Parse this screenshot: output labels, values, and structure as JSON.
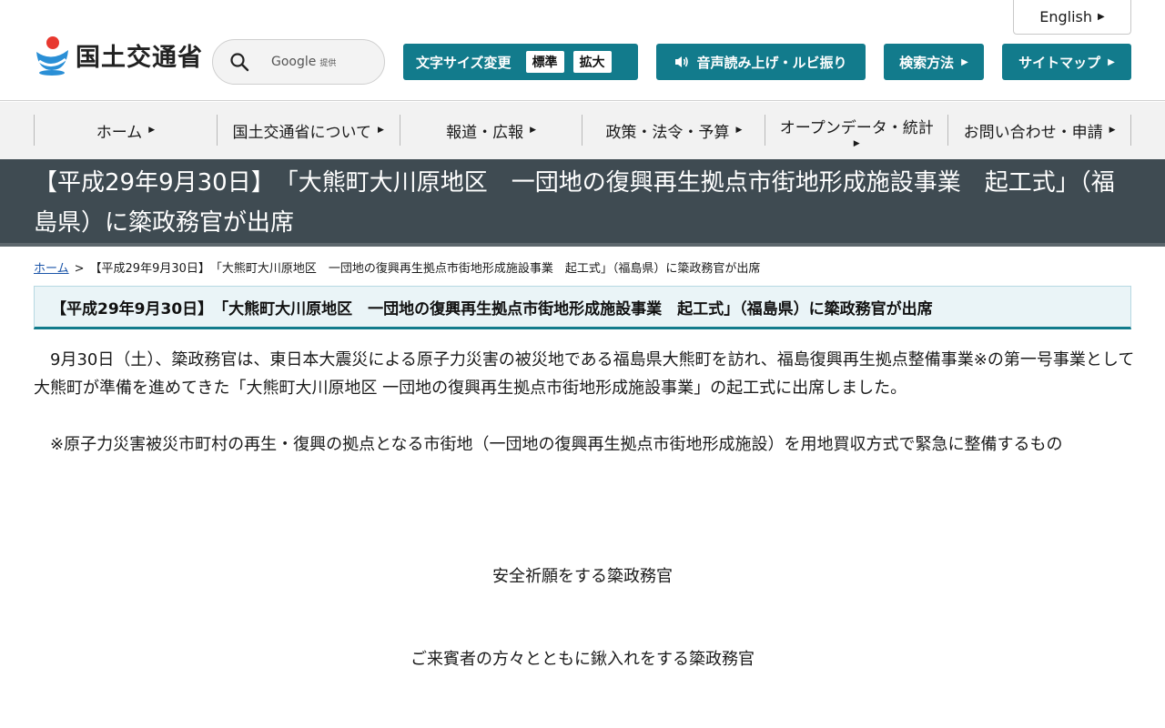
{
  "header": {
    "english_label": "English",
    "logo_text": "国土交通省",
    "search": {
      "provider": "Google",
      "provider_suffix": "提供"
    },
    "font_size": {
      "label": "文字サイズ変更",
      "standard": "標準",
      "large": "拡大"
    },
    "voice_label": "音声読み上げ・ルビ振り",
    "search_method_label": "検索方法",
    "sitemap_label": "サイトマップ",
    "accent_color": "#127b8c"
  },
  "nav": {
    "items": [
      {
        "label": "ホーム"
      },
      {
        "label": "国土交通省について"
      },
      {
        "label": "報道・広報"
      },
      {
        "label": "政策・法令・予算"
      },
      {
        "label": "オープンデータ・統計"
      },
      {
        "label": "お問い合わせ・申請"
      }
    ]
  },
  "page": {
    "title": "【平成29年9月30日】　「大熊町大川原地区　一団地の復興再生拠点市街地形成施設事業　起工式」（福島県）に簗政務官が出席",
    "breadcrumb": {
      "home": "ホーム",
      "separator": ">",
      "current": "【平成29年9月30日】　「大熊町大川原地区　一団地の復興再生拠点市街地形成施設事業　起工式」（福島県）に簗政務官が出席"
    },
    "heading": "【平成29年9月30日】　「大熊町大川原地区　一団地の復興再生拠点市街地形成施設事業　起工式」（福島県）に簗政務官が出席",
    "body": "9月30日（土）、簗政務官は、東日本大震災による原子力災害の被災地である福島県大熊町を訪れ、福島復興再生拠点整備事業※の第一号事業として大熊町が準備を進めてきた「大熊町大川原地区 一団地の復興再生拠点市街地形成施設事業」の起工式に出席しました。",
    "note": "※原子力災害被災市町村の再生・復興の拠点となる市街地（一団地の復興再生拠点市街地形成施設）を用地買収方式で緊急に整備するもの",
    "captions": [
      "安全祈願をする簗政務官",
      "ご来賓者の方々とともに鍬入れをする簗政務官"
    ]
  }
}
